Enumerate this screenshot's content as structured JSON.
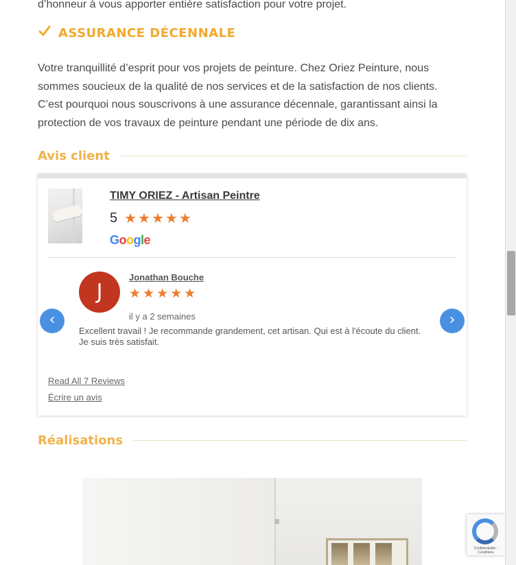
{
  "intro": {
    "tail_text": "d’honneur à vous apporter entière satisfaction pour votre projet."
  },
  "insurance": {
    "title": "ASSURANCE DÉCENNALE",
    "body": "Votre tranquillité d’esprit pour vos projets de peinture. Chez Oriez Peinture, nous sommes soucieux de la qualité de nos services et de la satisfaction de nos clients. C’est pourquoi nous souscrivons à une assurance décennale, garantissant ainsi la protection de vos travaux de peinture pendant une période de dix ans."
  },
  "avis": {
    "heading": "Avis client"
  },
  "review_widget": {
    "business_name": "TIMY ORIEZ - Artisan Peintre",
    "rating": "5",
    "rating_stars": 5,
    "stars_text": "★★★★★",
    "provider": "Google",
    "review": {
      "author_initial": "J",
      "author": "Jonathan Bouche",
      "stars_text": "★★★★★",
      "rating_stars": 5,
      "time": "il y a 2 semaines",
      "text": "Excellent travail ! Je recommande grandement, cet artisan. Qui est à l'écoute du client. Je suis très satisfait."
    },
    "read_all_label": "Read All 7 Reviews",
    "write_review_label": "Écrire un avis"
  },
  "realisations": {
    "heading": "Réalisations"
  },
  "recaptcha": {
    "terms": "Confidentialité - Conditions"
  },
  "colors": {
    "accent_gold": "#f0a92c",
    "star_orange": "#ec7d2d",
    "nav_blue": "#4a90e2",
    "avatar_red": "#c2351e"
  },
  "icons": {
    "check": "check-icon",
    "prev": "chevron-left-icon",
    "next": "chevron-right-icon"
  }
}
